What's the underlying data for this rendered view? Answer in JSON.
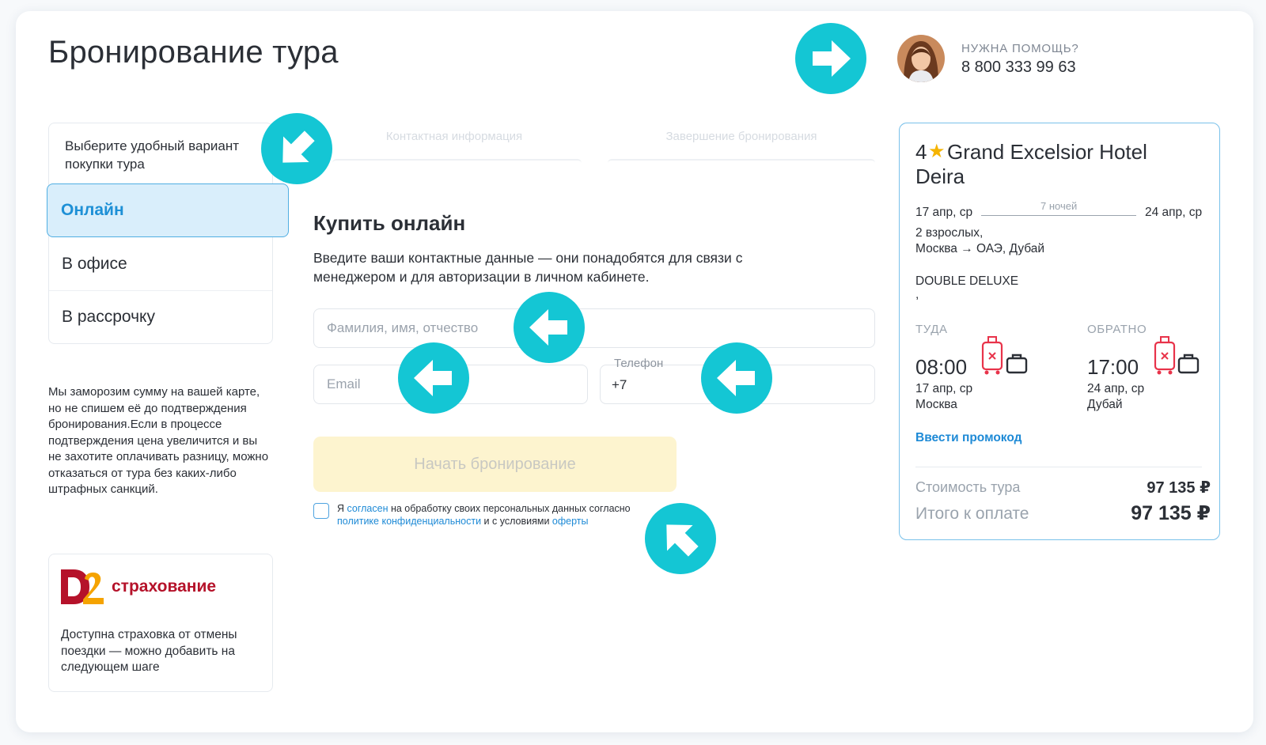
{
  "page": {
    "title": "Бронирование тура"
  },
  "help": {
    "label": "НУЖНА ПОМОЩЬ?",
    "phone": "8 800 333 99 63"
  },
  "purchase": {
    "prompt": "Выберите удобный вариант покупки тура",
    "tabs": [
      {
        "label": "Онлайн",
        "active": true
      },
      {
        "label": "В офисе",
        "active": false
      },
      {
        "label": "В рассрочку",
        "active": false
      }
    ]
  },
  "freeze_note": "Мы заморозим сумму на вашей карте, но не спишем её до подтверждения бронирования.Если в процессе подтверждения цена увеличится и вы не захотите оплачивать разницу, можно отказаться от тура без каких-либо штрафных санкций.",
  "insurance": {
    "brand": "страхование",
    "text": "Доступна страховка от отмены поездки — можно добавить на следующем шаге"
  },
  "steps": [
    "Контактная информация",
    "Завершение бронирования"
  ],
  "form": {
    "title": "Купить онлайн",
    "description": "Введите ваши контактные данные — они понадобятся для связи с менеджером и для авторизации в личном кабинете.",
    "fullname_placeholder": "Фамилия, имя, отчество",
    "email_placeholder": "Email",
    "phone_label": "Телефон",
    "phone_value": "+7",
    "submit_label": "Начать бронирование",
    "consent": {
      "t1": "Я ",
      "link1": "согласен",
      "t2": " на обработку своих персональных данных согласно ",
      "link2": "политике конфиденциальности",
      "t3": " и с условиями ",
      "link3": "оферты"
    }
  },
  "summary": {
    "stars": "4",
    "hotel_name": "Grand Excelsior Hotel",
    "hotel_name_2": "Deira",
    "date_from": "17 апр, ср",
    "nights": "7 ночей",
    "date_to": "24 апр, ср",
    "guests": "2 взрослых,",
    "route": "Москва → ОАЭ, Дубай",
    "room": "DOUBLE DELUXE",
    "room_extra": ",",
    "outbound": {
      "label": "ТУДА",
      "time": "08:00",
      "date": "17 апр, ср",
      "city": "Москва"
    },
    "return": {
      "label": "ОБРАТНО",
      "time": "17:00",
      "date": "24 апр, ср",
      "city": "Дубай"
    },
    "promo": "Ввести промокод",
    "cost_label": "Стоимость тура",
    "cost_value": "97 135 ₽",
    "total_label": "Итого к оплате",
    "total_value": "97 135 ₽"
  },
  "colors": {
    "accent": "#14c6d4",
    "link": "#1e8ad6",
    "active_tab_bg": "#d9eefb",
    "button_bg": "#fdf4cf",
    "star": "#f5b400",
    "insurance_red": "#b5122a",
    "luggage_red": "#e8334a"
  }
}
